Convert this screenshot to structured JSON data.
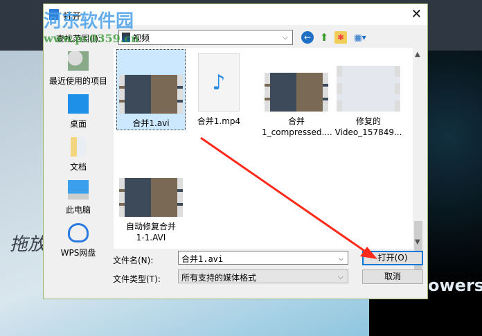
{
  "background": {
    "drop_text": "拖放",
    "brand_text": "owerso"
  },
  "watermark": {
    "name": "河东软件园",
    "url": "www.pc0359.cn"
  },
  "dialog": {
    "title": "打开",
    "close_icon": "close-icon",
    "lookin_label": "查找范围(I):",
    "lookin_value": "视频",
    "sidebar": [
      {
        "label": "最近使用的项目",
        "icon": "recent-icon"
      },
      {
        "label": "桌面",
        "icon": "desktop-icon"
      },
      {
        "label": "文档",
        "icon": "documents-icon"
      },
      {
        "label": "此电脑",
        "icon": "computer-icon"
      },
      {
        "label": "WPS网盘",
        "icon": "cloud-icon"
      }
    ],
    "files": [
      {
        "name": "合并1.avi",
        "selected": true
      },
      {
        "name": "合并1.mp4"
      },
      {
        "name": "合并\n1_compressed...."
      },
      {
        "name": "修复的\nVideo_157849..."
      },
      {
        "name": "自动修复合并\n1-1.AVI"
      }
    ],
    "filename_label": "文件名(N):",
    "filename_value": "合并1.avi",
    "filetype_label": "文件类型(T):",
    "filetype_value": "所有支持的媒体格式",
    "open_label": "打开(O)",
    "cancel_label": "取消"
  },
  "colors": {
    "accent": "#0078d7",
    "selection": "#cce8ff",
    "arrow": "#ff2a1a"
  }
}
